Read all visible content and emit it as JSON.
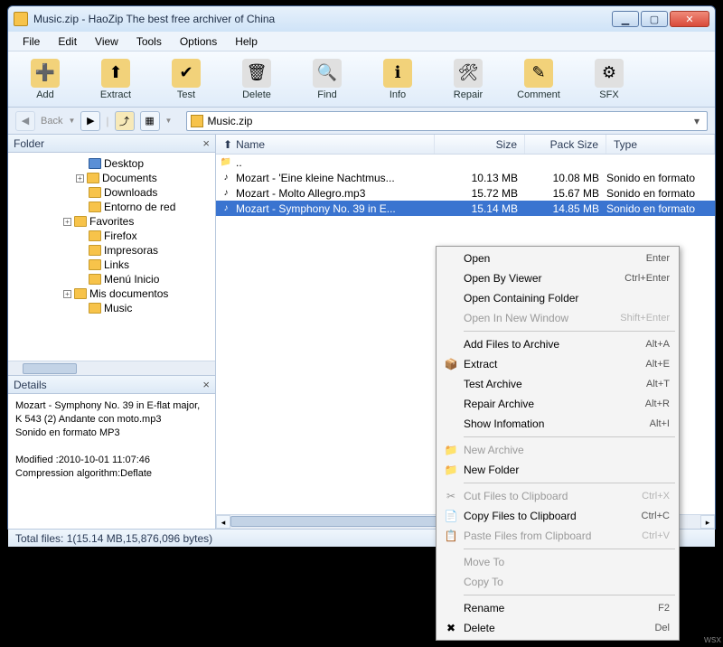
{
  "window": {
    "title": "Music.zip - HaoZip The best free archiver of China"
  },
  "menus": [
    "File",
    "Edit",
    "View",
    "Tools",
    "Options",
    "Help"
  ],
  "toolbar": [
    {
      "label": "Add",
      "icon": "➕",
      "bg": "#f2d27a"
    },
    {
      "label": "Extract",
      "icon": "⬆",
      "bg": "#f2d27a"
    },
    {
      "label": "Test",
      "icon": "✔",
      "bg": "#f2d27a"
    },
    {
      "label": "Delete",
      "icon": "🗑",
      "bg": "#e0e0e0"
    },
    {
      "label": "Find",
      "icon": "🔍",
      "bg": "#e0e0e0"
    },
    {
      "label": "Info",
      "icon": "ℹ",
      "bg": "#f2d27a"
    },
    {
      "label": "Repair",
      "icon": "🛠",
      "bg": "#e0e0e0"
    },
    {
      "label": "Comment",
      "icon": "✎",
      "bg": "#f2d27a"
    },
    {
      "label": "SFX",
      "icon": "⚙",
      "bg": "#e0e0e0"
    }
  ],
  "nav": {
    "back_label": "Back",
    "address": "Music.zip"
  },
  "folder_pane": {
    "title": "Folder"
  },
  "tree": [
    {
      "indent": 70,
      "tw": "",
      "cls": "desk",
      "label": "Desktop"
    },
    {
      "indent": 70,
      "tw": "+",
      "cls": "",
      "label": "Documents"
    },
    {
      "indent": 70,
      "tw": "",
      "cls": "",
      "label": "Downloads"
    },
    {
      "indent": 70,
      "tw": "",
      "cls": "",
      "label": "Entorno de red"
    },
    {
      "indent": 56,
      "tw": "+",
      "cls": "",
      "label": "Favorites"
    },
    {
      "indent": 70,
      "tw": "",
      "cls": "",
      "label": "Firefox"
    },
    {
      "indent": 70,
      "tw": "",
      "cls": "",
      "label": "Impresoras"
    },
    {
      "indent": 70,
      "tw": "",
      "cls": "",
      "label": "Links"
    },
    {
      "indent": 70,
      "tw": "",
      "cls": "",
      "label": "Menú Inicio"
    },
    {
      "indent": 56,
      "tw": "+",
      "cls": "",
      "label": "Mis documentos"
    },
    {
      "indent": 70,
      "tw": "",
      "cls": "",
      "label": "Music"
    }
  ],
  "details_pane": {
    "title": "Details"
  },
  "details_text": [
    "Mozart - Symphony No. 39 in E-flat major, K 543 (2) Andante con moto.mp3",
    "Sonido en formato MP3",
    "",
    "Modified :2010-10-01 11:07:46",
    "Compression algorithm:Deflate"
  ],
  "columns": {
    "name": "Name",
    "size": "Size",
    "pack": "Pack Size",
    "type": "Type"
  },
  "files": [
    {
      "icon": "📁",
      "name": "..",
      "size": "",
      "pack": "",
      "type": "",
      "sel": false
    },
    {
      "icon": "♪",
      "name": "Mozart - 'Eine kleine Nachtmus...",
      "size": "10.13 MB",
      "pack": "10.08 MB",
      "type": "Sonido en formato",
      "sel": false
    },
    {
      "icon": "♪",
      "name": "Mozart - Molto Allegro.mp3",
      "size": "15.72 MB",
      "pack": "15.67 MB",
      "type": "Sonido en formato",
      "sel": false
    },
    {
      "icon": "♪",
      "name": "Mozart - Symphony No. 39 in E...",
      "size": "15.14 MB",
      "pack": "14.85 MB",
      "type": "Sonido en formato",
      "sel": true
    }
  ],
  "status": "Total files: 1(15.14 MB,15,876,096 bytes)",
  "context_menu": [
    {
      "label": "Open",
      "shortcut": "Enter",
      "dis": false,
      "icon": ""
    },
    {
      "label": "Open By Viewer",
      "shortcut": "Ctrl+Enter",
      "dis": false,
      "icon": ""
    },
    {
      "label": "Open Containing Folder",
      "shortcut": "",
      "dis": false,
      "icon": ""
    },
    {
      "label": "Open In New Window",
      "shortcut": "Shift+Enter",
      "dis": true,
      "icon": ""
    },
    {
      "sep": true
    },
    {
      "label": "Add Files to Archive",
      "shortcut": "Alt+A",
      "dis": false,
      "icon": ""
    },
    {
      "label": "Extract",
      "shortcut": "Alt+E",
      "dis": false,
      "icon": "📦"
    },
    {
      "label": "Test Archive",
      "shortcut": "Alt+T",
      "dis": false,
      "icon": ""
    },
    {
      "label": "Repair Archive",
      "shortcut": "Alt+R",
      "dis": false,
      "icon": ""
    },
    {
      "label": "Show Infomation",
      "shortcut": "Alt+I",
      "dis": false,
      "icon": ""
    },
    {
      "sep": true
    },
    {
      "label": "New Archive",
      "shortcut": "",
      "dis": true,
      "icon": "📁"
    },
    {
      "label": "New Folder",
      "shortcut": "",
      "dis": false,
      "icon": "📁"
    },
    {
      "sep": true
    },
    {
      "label": "Cut Files to Clipboard",
      "shortcut": "Ctrl+X",
      "dis": true,
      "icon": "✂"
    },
    {
      "label": "Copy Files to Clipboard",
      "shortcut": "Ctrl+C",
      "dis": false,
      "icon": "📄"
    },
    {
      "label": "Paste Files from Clipboard",
      "shortcut": "Ctrl+V",
      "dis": true,
      "icon": "📋"
    },
    {
      "sep": true
    },
    {
      "label": "Move To",
      "shortcut": "",
      "dis": true,
      "icon": ""
    },
    {
      "label": "Copy To",
      "shortcut": "",
      "dis": true,
      "icon": ""
    },
    {
      "sep": true
    },
    {
      "label": "Rename",
      "shortcut": "F2",
      "dis": false,
      "icon": ""
    },
    {
      "label": "Delete",
      "shortcut": "Del",
      "dis": false,
      "icon": "✖"
    }
  ],
  "watermark": "wsx"
}
